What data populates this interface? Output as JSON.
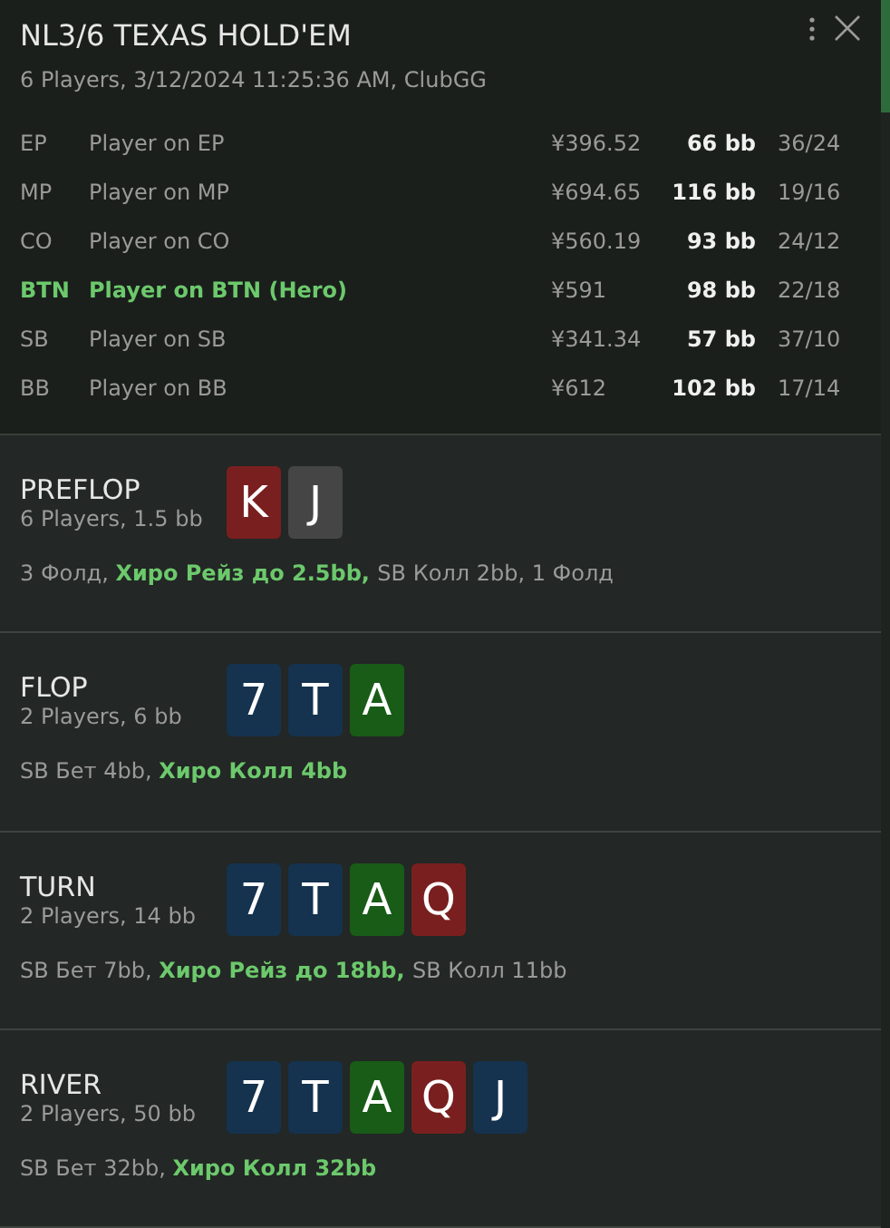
{
  "header": {
    "title": "NL3/6 TEXAS HOLD'EM",
    "subtitle": "6 Players, 3/12/2024 11:25:36 AM, ClubGG"
  },
  "players": [
    {
      "position": "EP",
      "name": "Player on EP",
      "stack": "¥396.52",
      "bb": "66 bb",
      "stats": "36/24",
      "hero": false
    },
    {
      "position": "MP",
      "name": "Player on MP",
      "stack": "¥694.65",
      "bb": "116 bb",
      "stats": "19/16",
      "hero": false
    },
    {
      "position": "CO",
      "name": "Player on CO",
      "stack": "¥560.19",
      "bb": "93 bb",
      "stats": "24/12",
      "hero": false
    },
    {
      "position": "BTN",
      "name": "Player on BTN (Hero)",
      "stack": "¥591",
      "bb": "98 bb",
      "stats": "22/18",
      "hero": true
    },
    {
      "position": "SB",
      "name": "Player on SB",
      "stack": "¥341.34",
      "bb": "57 bb",
      "stats": "37/10",
      "hero": false
    },
    {
      "position": "BB",
      "name": "Player on BB",
      "stack": "¥612",
      "bb": "102 bb",
      "stats": "17/14",
      "hero": false
    }
  ],
  "streets": [
    {
      "name": "PREFLOP",
      "info": "6 Players, 1.5 bb",
      "cards": [
        {
          "rank": "K",
          "color": "#7a1f1f"
        },
        {
          "rank": "J",
          "color": "#454545"
        }
      ],
      "actions": [
        {
          "text": "3 Фолд, ",
          "hero": false
        },
        {
          "text": "Хиро Рейз до 2.5bb, ",
          "hero": true
        },
        {
          "text": "SB Колл 2bb, 1 Фолд",
          "hero": false
        }
      ]
    },
    {
      "name": "FLOP",
      "info": "2 Players, 6 bb",
      "cards": [
        {
          "rank": "7",
          "color": "#15324f"
        },
        {
          "rank": "T",
          "color": "#15324f"
        },
        {
          "rank": "A",
          "color": "#185c18"
        }
      ],
      "actions": [
        {
          "text": "SB Бет 4bb, ",
          "hero": false
        },
        {
          "text": "Хиро Колл 4bb",
          "hero": true
        }
      ]
    },
    {
      "name": "TURN",
      "info": "2 Players, 14 bb",
      "cards": [
        {
          "rank": "7",
          "color": "#15324f"
        },
        {
          "rank": "T",
          "color": "#15324f"
        },
        {
          "rank": "A",
          "color": "#185c18"
        },
        {
          "rank": "Q",
          "color": "#7a1f1f"
        }
      ],
      "actions": [
        {
          "text": "SB Бет 7bb, ",
          "hero": false
        },
        {
          "text": "Хиро Рейз до 18bb, ",
          "hero": true
        },
        {
          "text": "SB Колл 11bb",
          "hero": false
        }
      ]
    },
    {
      "name": "RIVER",
      "info": "2 Players, 50 bb",
      "cards": [
        {
          "rank": "7",
          "color": "#15324f"
        },
        {
          "rank": "T",
          "color": "#15324f"
        },
        {
          "rank": "A",
          "color": "#185c18"
        },
        {
          "rank": "Q",
          "color": "#7a1f1f"
        },
        {
          "rank": "J",
          "color": "#15324f"
        }
      ],
      "actions": [
        {
          "text": "SB Бет 32bb, ",
          "hero": false
        },
        {
          "text": "Хиро Колл 32bb",
          "hero": true
        }
      ]
    }
  ]
}
